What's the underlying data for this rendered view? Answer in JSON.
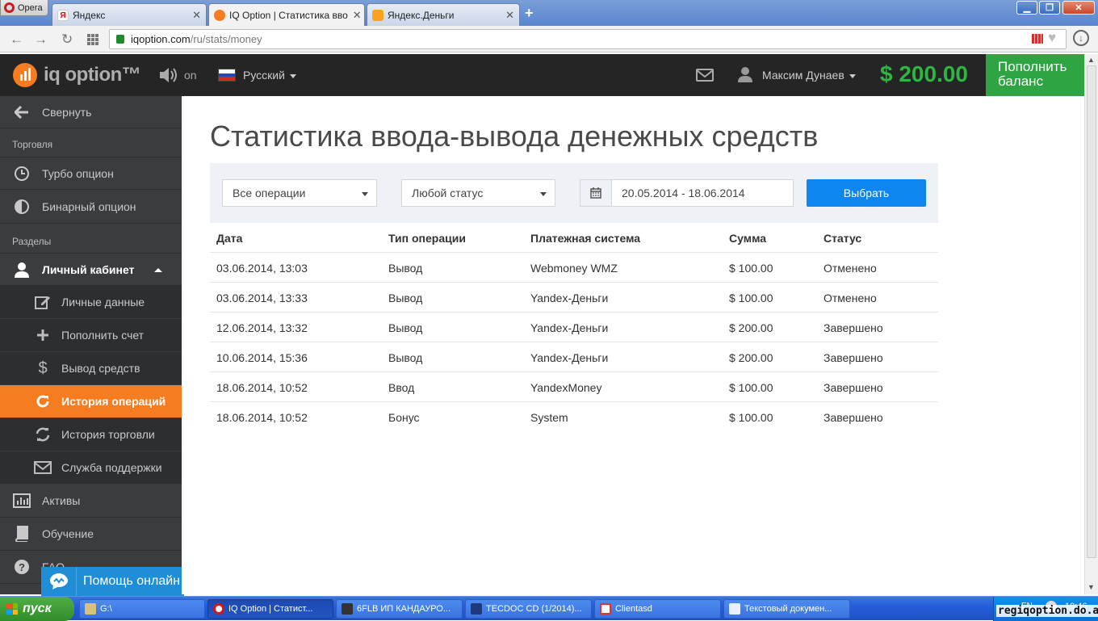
{
  "browser": {
    "menu_label": "Opera",
    "tabs": [
      {
        "title": "Яндекс",
        "favicon": "yandex-icon"
      },
      {
        "title": "IQ Option | Статистика вво",
        "favicon": "iqoption-icon"
      },
      {
        "title": "Яндекс.Деньги",
        "favicon": "yandex-money-icon"
      }
    ],
    "url_host": "iqoption.com",
    "url_path": "/ru/stats/money"
  },
  "header": {
    "logo": "iq option™",
    "sound_label": "on",
    "language": "Русский",
    "username": "Максим Дунаев",
    "balance": "$ 200.00",
    "deposit_label": "Пополнить баланс",
    "colors": {
      "accent": "#f57c20",
      "balance": "#2db741",
      "deposit": "#2ea542"
    }
  },
  "sidebar": {
    "collapse_label": "Свернуть",
    "trading_heading": "Торговля",
    "trading_items": [
      {
        "label": "Турбо опцион",
        "icon": "clock-icon"
      },
      {
        "label": "Бинарный опцион",
        "icon": "clock-half-icon"
      }
    ],
    "sections_heading": "Разделы",
    "cabinet_label": "Личный кабинет",
    "cabinet_items": [
      {
        "label": "Личные данные",
        "icon": "edit-icon"
      },
      {
        "label": "Пополнить счет",
        "icon": "plus-icon"
      },
      {
        "label": "Вывод средств",
        "icon": "dollar-icon"
      },
      {
        "label": "История операций",
        "icon": "refresh-icon",
        "active": true
      },
      {
        "label": "История торговли",
        "icon": "sync-icon"
      },
      {
        "label": "Служба поддержки",
        "icon": "envelope-icon"
      }
    ],
    "bottom_items": [
      {
        "label": "Активы",
        "icon": "bar-chart-icon"
      },
      {
        "label": "Обучение",
        "icon": "book-icon"
      },
      {
        "label": "FAQ",
        "icon": "question-icon"
      }
    ],
    "help_label": "Помощь онлайн"
  },
  "main": {
    "title": "Статистика ввода-вывода денежных средств",
    "filters": {
      "operations": "Все операции",
      "status": "Любой статус",
      "date_range": "20.05.2014 - 18.06.2014",
      "submit_label": "Выбрать"
    },
    "table": {
      "headers": [
        "Дата",
        "Тип операции",
        "Платежная система",
        "Сумма",
        "Статус"
      ],
      "rows": [
        [
          "03.06.2014, 13:03",
          "Вывод",
          "Webmoney WMZ",
          "$ 100.00",
          "Отменено"
        ],
        [
          "03.06.2014, 13:33",
          "Вывод",
          "Yandex-Деньги",
          "$ 100.00",
          "Отменено"
        ],
        [
          "12.06.2014, 13:32",
          "Вывод",
          "Yandex-Деньги",
          "$ 200.00",
          "Завершено"
        ],
        [
          "10.06.2014, 15:36",
          "Вывод",
          "Yandex-Деньги",
          "$ 200.00",
          "Завершено"
        ],
        [
          "18.06.2014, 10:52",
          "Ввод",
          "YandexMoney",
          "$ 100.00",
          "Завершено"
        ],
        [
          "18.06.2014, 10:52",
          "Бонус",
          "System",
          "$ 100.00",
          "Завершено"
        ]
      ]
    }
  },
  "taskbar": {
    "start_label": "пуск",
    "tasks": [
      {
        "label": "G:\\",
        "icon": "folder-icon"
      },
      {
        "label": "IQ Option | Статист...",
        "icon": "opera-icon",
        "active": true
      },
      {
        "label": "6FLB ИП КАНДАУРО...",
        "icon": "app-icon"
      },
      {
        "label": "TECDOC CD (1/2014)...",
        "icon": "tecdoc-icon"
      },
      {
        "label": "Clientasd",
        "icon": "window-icon"
      },
      {
        "label": "Текстовый докумен...",
        "icon": "notepad-icon"
      }
    ],
    "tray_lang": "EN",
    "clock": "10:46"
  },
  "watermark": "regiqoption.do.am"
}
